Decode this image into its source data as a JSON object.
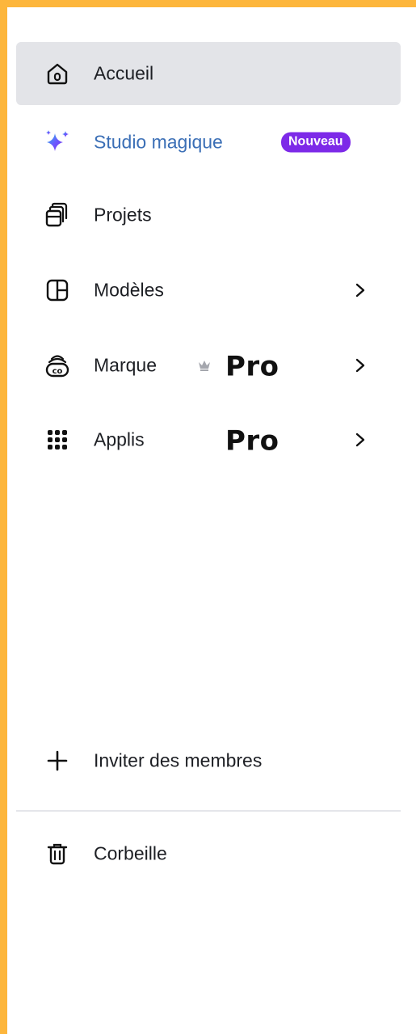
{
  "nav": {
    "items": [
      {
        "label": "Accueil",
        "icon": "home-icon"
      },
      {
        "label": "Studio magique",
        "icon": "sparkles-icon",
        "badge": "Nouveau"
      },
      {
        "label": "Projets",
        "icon": "folder-icon"
      },
      {
        "label": "Modèles",
        "icon": "template-icon"
      },
      {
        "label": "Marque",
        "icon": "brand-icon",
        "pro": "Pro"
      },
      {
        "label": "Applis",
        "icon": "apps-grid-icon",
        "pro": "Pro"
      }
    ]
  },
  "footer": {
    "invite_label": "Inviter des membres",
    "trash_label": "Corbeille"
  },
  "colors": {
    "frame": "#FDB63C",
    "active_bg": "#E3E4E8",
    "magic_text": "#3b6fb6",
    "badge_bg": "#7d2ae8"
  }
}
